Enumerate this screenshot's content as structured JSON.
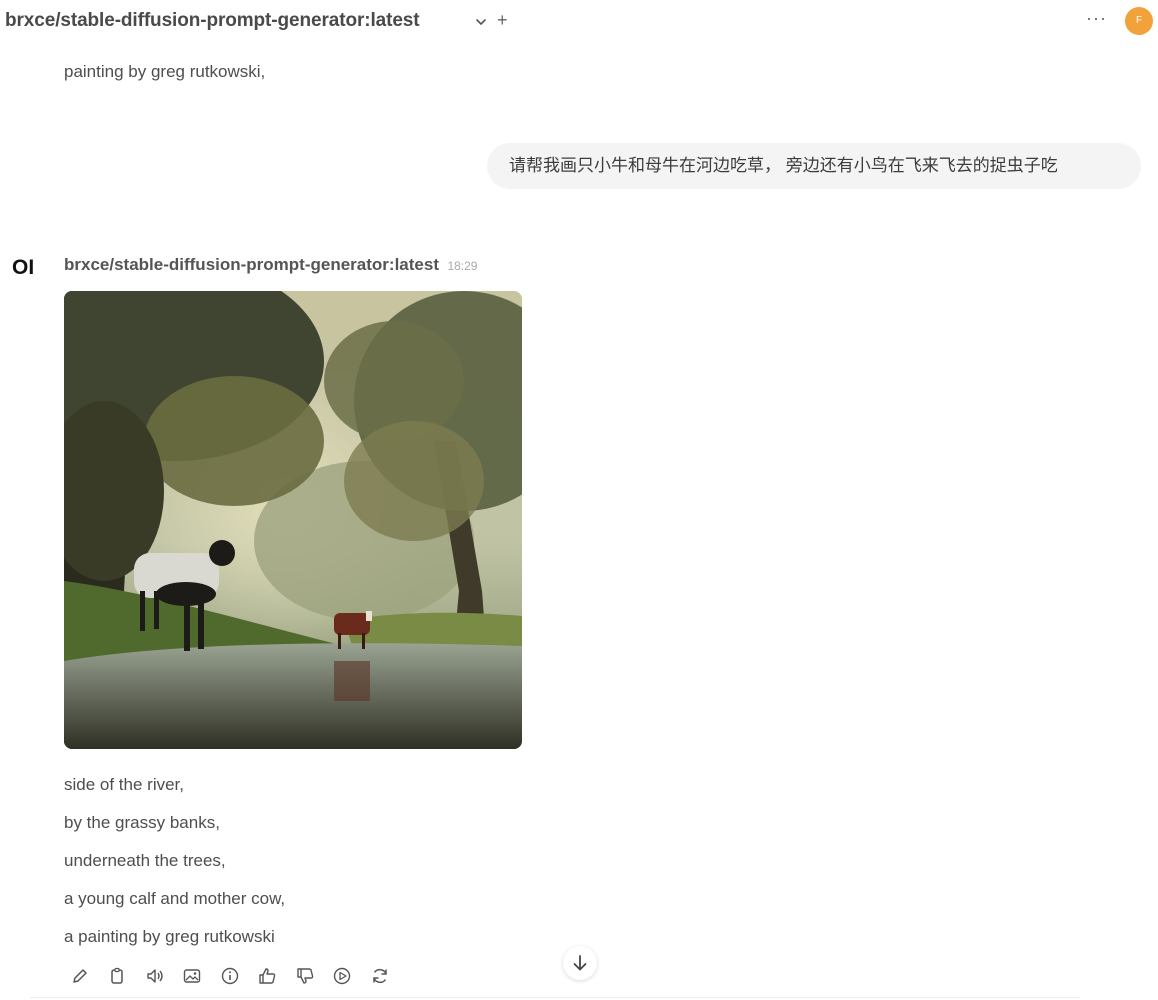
{
  "header": {
    "model_title": "brxce/stable-diffusion-prompt-generator:latest",
    "plus": "+",
    "more": "···",
    "avatar_initial": "F"
  },
  "chat": {
    "previous_line": "painting by greg rutkowski,",
    "user_message": "请帮我画只小牛和母牛在河边吃草， 旁边还有小鸟在飞来飞去的捉虫子吃",
    "response": {
      "logo": "OI",
      "model_name": "brxce/stable-diffusion-prompt-generator:latest",
      "time": "18:29",
      "image_subject": "calf and cow by a river under trees",
      "lines": [
        "side of the river,",
        "by the grassy banks,",
        "underneath the trees,",
        "a young calf and mother cow,",
        "a painting by greg rutkowski"
      ]
    }
  },
  "actions": [
    "edit-icon",
    "copy-icon",
    "speaker-icon",
    "image-icon",
    "info-icon",
    "thumbs-up-icon",
    "thumbs-down-icon",
    "play-icon",
    "regenerate-icon"
  ],
  "colors": {
    "avatar": "#f2a23a",
    "bubble": "#f4f4f5",
    "text": "#4b4b4b"
  }
}
